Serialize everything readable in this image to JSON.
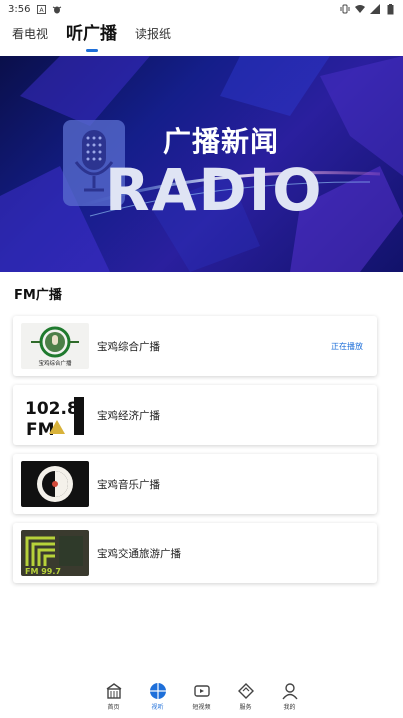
{
  "status_bar": {
    "time": "3:56",
    "left_icons": [
      "text-a-icon",
      "bug-icon"
    ],
    "right_icons": [
      "vibrate-icon",
      "wifi-icon",
      "signal-icon",
      "battery-icon"
    ]
  },
  "tabs": [
    {
      "label": "看电视",
      "active": false
    },
    {
      "label": "听广播",
      "active": true
    },
    {
      "label": "读报纸",
      "active": false
    }
  ],
  "banner": {
    "title": "广播新闻",
    "subtitle": "RADIO"
  },
  "section_title": "FM广播",
  "stations": [
    {
      "name": "宝鸡综合广播",
      "status": "正在播放",
      "logo_text": "宝鸡综合广播"
    },
    {
      "name": "宝鸡经济广播",
      "status": "",
      "logo_text": "102.8",
      "logo_sub": "FM"
    },
    {
      "name": "宝鸡音乐广播",
      "status": "",
      "logo_text": ""
    },
    {
      "name": "宝鸡交通旅游广播",
      "status": "",
      "logo_text": "FM 99.7"
    }
  ],
  "bottom_nav": [
    {
      "label": "首页",
      "icon": "home-icon",
      "active": false
    },
    {
      "label": "视听",
      "icon": "globe-icon",
      "active": true
    },
    {
      "label": "短视频",
      "icon": "video-icon",
      "active": false
    },
    {
      "label": "服务",
      "icon": "service-icon",
      "active": false
    },
    {
      "label": "我的",
      "icon": "user-icon",
      "active": false
    }
  ],
  "colors": {
    "accent": "#1e6fd9",
    "banner_dark": "#0a0f4a"
  }
}
